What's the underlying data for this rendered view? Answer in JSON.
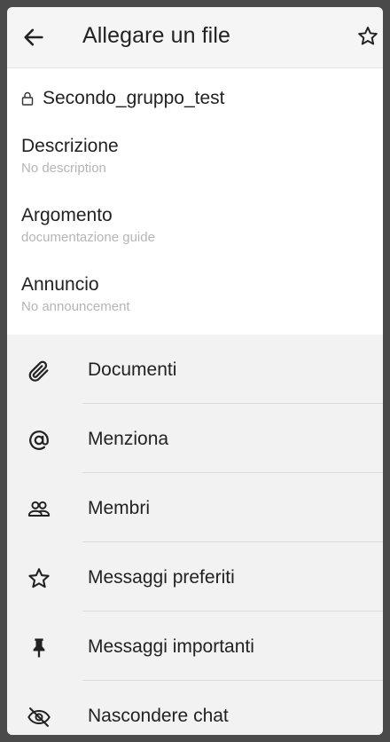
{
  "header": {
    "title": "Allegare un file",
    "back_icon": "arrow-left-icon",
    "star_icon": "star-outline-icon"
  },
  "room": {
    "name": "Secondo_gruppo_test",
    "lock_icon": "lock-icon"
  },
  "fields": {
    "description": {
      "label": "Descrizione",
      "value": "No description"
    },
    "topic": {
      "label": "Argomento",
      "value": "documentazione guide"
    },
    "announcement": {
      "label": "Annuncio",
      "value": "No announcement"
    }
  },
  "menu": {
    "items": [
      {
        "label": "Documenti",
        "icon": "paperclip-icon"
      },
      {
        "label": "Menziona",
        "icon": "at-sign-icon"
      },
      {
        "label": "Membri",
        "icon": "members-icon"
      },
      {
        "label": "Messaggi preferiti",
        "icon": "star-outline-icon"
      },
      {
        "label": "Messaggi importanti",
        "icon": "pin-icon"
      },
      {
        "label": "Nascondere chat",
        "icon": "eye-off-icon"
      }
    ]
  },
  "colors": {
    "text": "#222222",
    "subtext": "#b5b5b5",
    "background": "#f2f2f2",
    "card": "#ffffff"
  }
}
